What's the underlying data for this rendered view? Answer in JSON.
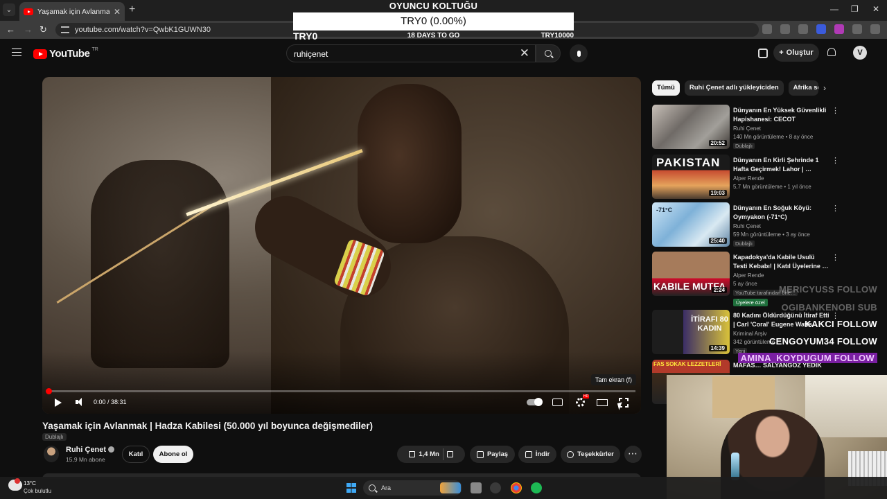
{
  "browser": {
    "tab_title": "Yaşamak için Avlanmak | Hadza",
    "url": "youtube.com/watch?v=QwbK1GUWN30"
  },
  "overlay": {
    "title": "OYUNCU KOLTUĞU",
    "amount": "TRY0 (0.00%)",
    "left_label": "TRY0",
    "days": "18 DAYS TO GO",
    "right_label": "TRY10000",
    "progress_fraction": 0.0
  },
  "youtube": {
    "logo_text": "YouTube",
    "country": "TR",
    "search_value": "ruhiçenet",
    "create_label": "Oluştur",
    "avatar_letter": "V"
  },
  "player": {
    "tooltip": "Tam ekran (f)",
    "time": "0:00 / 38:31",
    "progress_fraction": 0.0
  },
  "video": {
    "title": "Yaşamak için Avlanmak | Hadza Kabilesi (50.000 yıl boyunca değişmediler)",
    "dub_badge": "Dublajlı",
    "channel": "Ruhi Çenet",
    "subscribers": "15,9 Mn abone",
    "join": "Katıl",
    "subscribe": "Abone ol",
    "likes": "1,4 Mn",
    "share": "Paylaş",
    "download": "İndir",
    "thanks": "Teşekkürler"
  },
  "chips": [
    "Tümü",
    "Ruhi Çenet adlı yükleyiciden",
    "Afrika seyahati"
  ],
  "recommendations": [
    {
      "title": "Dünyanın En Yüksek Güvenlikli Hapishanesi: CECOT (Şeytanla…",
      "channel": "Ruhi Çenet",
      "meta": "140 Mn görüntüleme • 8 ay önce",
      "duration": "20:52",
      "badge": "Dublajlı",
      "thumb_text": ""
    },
    {
      "title": "Dünyanın En Kirli Şehrinde 1 Hafta Geçirmek! Lahor | …",
      "channel": "Alper Rende",
      "meta": "5,7 Mn görüntüleme • 1 yıl önce",
      "duration": "19:03",
      "badge": "",
      "thumb_text": "PAKISTAN"
    },
    {
      "title": "Dünyanın En Soğuk Köyü: Oymyakon (-71°C)",
      "channel": "Ruhi Çenet",
      "meta": "59 Mn görüntüleme • 3 ay önce",
      "duration": "25:40",
      "badge": "Dublajlı",
      "thumb_text": "-71°C"
    },
    {
      "title": "Kapadokya'da Kabile Usulü Testi Kebabı! | Katıl Üyelerine …",
      "channel": "Alper Rende",
      "meta": "5 ay önce",
      "duration": "2:24",
      "badge": "YouTube tarafından öne…",
      "members": "Üyelere özel",
      "thumb_text": "KABILE MUTFA"
    },
    {
      "title": "80 Kadını Öldürdüğünü İtiraf Etti | Carl 'Coral' Eugene Watts",
      "channel": "Kriminal Arşiv",
      "meta": "342 görüntüleme",
      "duration": "14:39",
      "badge": "Yeni",
      "thumb_text": "İTİRAFI 80 KADIN"
    },
    {
      "title": "MAFAS… SALYANGOZ YEDİK",
      "channel": "",
      "meta": "",
      "duration": "",
      "badge": "",
      "thumb_text": "FAS SOKAK LEZZETLERİ"
    }
  ],
  "follows": [
    {
      "text": "MERICYUSS  FOLLOW",
      "style": "dim"
    },
    {
      "text": "OGIBANKENOBI  SUB",
      "style": "dim"
    },
    {
      "text": "KAKCI  FOLLOW",
      "style": "bright"
    },
    {
      "text": "CENGOYUM34  FOLLOW",
      "style": "bright"
    },
    {
      "text": "AMINA_KOYDUGUM  FOLLOW",
      "style": "purple"
    }
  ],
  "taskbar": {
    "temp": "13°C",
    "condition": "Çok bulutlu",
    "search": "Ara"
  }
}
